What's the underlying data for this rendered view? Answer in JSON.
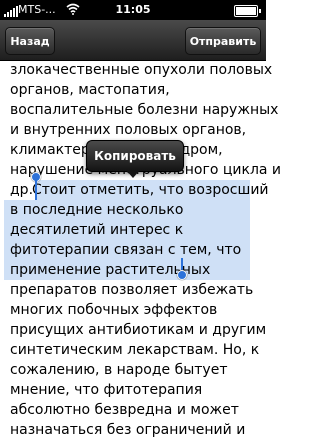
{
  "status_bar": {
    "carrier": "MTS-...",
    "time": "11:05"
  },
  "nav": {
    "back_label": "Назад",
    "send_label": "Отправить"
  },
  "popup": {
    "copy_label": "Копировать"
  },
  "text": {
    "lines": [
      "злокачественные опухоли половых",
      "органов, мастопатия,",
      "воспалительные болезни наружных",
      "и внутренних половых органов,",
      "климактерический синдром,",
      "нарушение менструального цикла и",
      "др.",
      " Стоит отметить, что возросший",
      "в последние несколько",
      "десятилетий интерес к",
      "фитотерапии связан с тем, что",
      "применение растительных",
      "препаратов позволяет избежать",
      "многих побочных эффектов",
      "присущих антибиотикам и другим",
      "синтетическим лекарствам. Но, к",
      "сожалению, в народе бытует",
      "мнение, что фитотерапия",
      "абсолютно безвредна и может",
      "назначаться без ограничений и"
    ]
  },
  "colors": {
    "selection": "#cfe0f6",
    "handle": "#2d72d9",
    "nav_bar": "#2e2e2e"
  }
}
